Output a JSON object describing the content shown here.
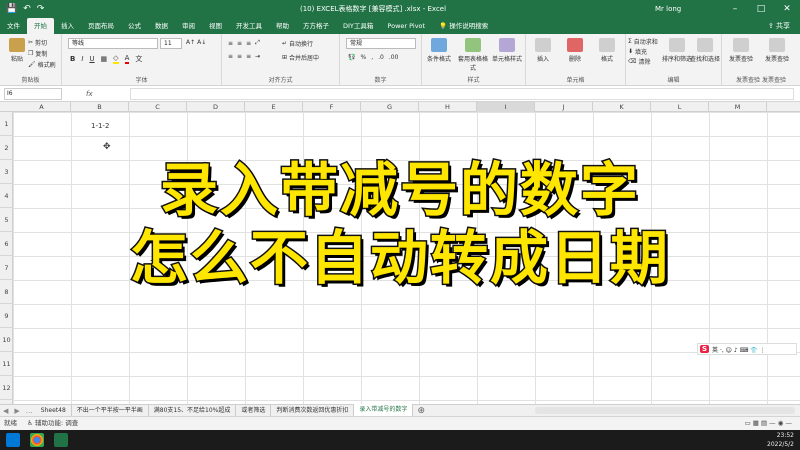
{
  "window": {
    "title": "(10) EXCEL表格数字 [兼容模式] .xlsx - Excel",
    "user": "Mr long",
    "share_label": "共享"
  },
  "qat": {
    "save": "💾",
    "undo": "↶",
    "redo": "↷"
  },
  "ribbon_tabs": [
    "文件",
    "开始",
    "插入",
    "页面布局",
    "公式",
    "数据",
    "审阅",
    "视图",
    "开发工具",
    "帮助",
    "方方格子",
    "DIY工具箱",
    "Power Pivot",
    "操作说明搜索"
  ],
  "active_tab": "开始",
  "ribbon": {
    "clipboard": {
      "paste": "粘贴",
      "cut": "剪切",
      "copy": "复制",
      "format_painter": "格式刷",
      "label": "剪贴板"
    },
    "font": {
      "name": "等线",
      "size": "11",
      "label": "字体"
    },
    "alignment": {
      "wrap": "自动换行",
      "merge": "合并后居中",
      "label": "对齐方式"
    },
    "number": {
      "format": "常规",
      "label": "数字"
    },
    "styles": {
      "cond": "条件格式",
      "table": "套用表格格式",
      "cell": "单元格样式",
      "label": "样式"
    },
    "cells": {
      "insert": "插入",
      "delete": "删除",
      "format": "格式",
      "label": "单元格"
    },
    "editing": {
      "autosum": "自动求和",
      "fill": "填充",
      "clear": "清除",
      "sort": "排序和筛选",
      "find": "查找和选择",
      "label": "编辑"
    },
    "invoice": {
      "btn1": "发票查验",
      "btn2": "发票查验",
      "label1": "发票查验",
      "label2": "发票查验"
    }
  },
  "formula_bar": {
    "name_box": "I6",
    "fx": "fx",
    "content": ""
  },
  "columns": [
    "A",
    "B",
    "C",
    "D",
    "E",
    "F",
    "G",
    "H",
    "I",
    "J",
    "K",
    "L",
    "M"
  ],
  "rows": [
    "1",
    "2",
    "3",
    "4",
    "5",
    "6",
    "7",
    "8",
    "9",
    "10",
    "11",
    "12"
  ],
  "cells": {
    "B1": "1-1-2"
  },
  "overlay": {
    "line1": "录入带减号的数字",
    "line2": "怎么不自动转成日期"
  },
  "ime": {
    "logo": "S",
    "text": "英 ·, ☺ ♪ ⌨ 👕 ⋮"
  },
  "sheets": [
    "Sheet48",
    "不出一个平半按一平半画",
    "满80支15、不足给10%超成",
    "或者筛选",
    "判断消费次数返回优惠折扣",
    "录入带减号的数字"
  ],
  "active_sheet": "录入带减号的数字",
  "status": {
    "ready": "就绪",
    "accessibility": "辅助功能: 调查"
  },
  "taskbar": {
    "time": "23:52",
    "date": "2022/5/2"
  },
  "colors": {
    "excel_green": "#217346",
    "overlay_yellow": "#ffe600"
  }
}
